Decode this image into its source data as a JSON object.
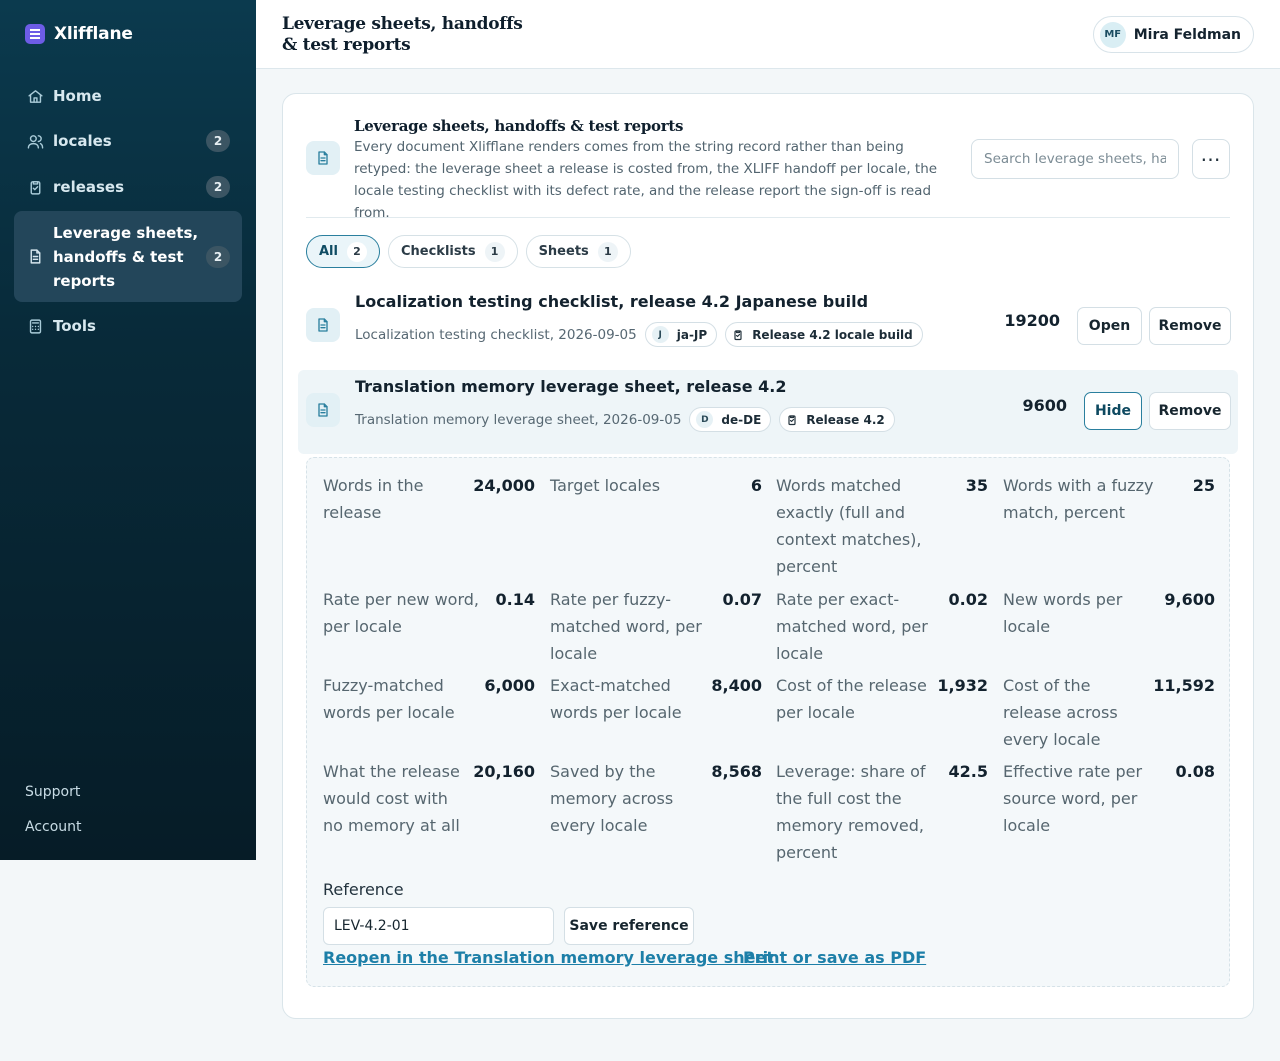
{
  "app": {
    "name": "Xlifflane"
  },
  "sidebar": {
    "items": [
      {
        "label": "Home",
        "icon": "home-icon"
      },
      {
        "label": "locales",
        "badge": "2",
        "icon": "users-icon"
      },
      {
        "label": "releases",
        "badge": "2",
        "icon": "clipboard-icon"
      },
      {
        "label": "Leverage sheets, handoffs & test reports",
        "badge": "2",
        "icon": "document-icon",
        "active": true
      },
      {
        "label": "Tools",
        "icon": "calculator-icon"
      }
    ],
    "footer": {
      "support": "Support",
      "account": "Account"
    }
  },
  "topbar": {
    "title": "Leverage sheets, handoffs & test reports",
    "user": {
      "initials": "MF",
      "name": "Mira Feldman"
    }
  },
  "card": {
    "title": "Leverage sheets, handoffs & test reports",
    "description": "Every document Xlifflane renders comes from the string record rather than being retyped: the leverage sheet a release is costed from, the XLIFF handoff per locale, the locale testing checklist with its defect rate, and the release report the sign-off is read from.",
    "search_placeholder": "Search leverage sheets, handoffs",
    "filters": [
      {
        "label": "All",
        "count": "2",
        "active": true
      },
      {
        "label": "Checklists",
        "count": "1"
      },
      {
        "label": "Sheets",
        "count": "1"
      }
    ],
    "rows": [
      {
        "title": "Localization testing checklist, release 4.2 Japanese build",
        "meta": "Localization testing checklist, 2026-09-05",
        "locale_initial": "J",
        "locale": "ja-JP",
        "release": "Release 4.2 locale build",
        "number": "19200",
        "primary": "Open",
        "remove": "Remove"
      },
      {
        "title": "Translation memory leverage sheet, release 4.2",
        "meta": "Translation memory leverage sheet, 2026-09-05",
        "locale_initial": "D",
        "locale": "de-DE",
        "release": "Release 4.2",
        "number": "9600",
        "primary": "Hide",
        "remove": "Remove"
      }
    ],
    "details": {
      "metrics": [
        {
          "label": "Words in the release",
          "value": "24,000"
        },
        {
          "label": "Target locales",
          "value": "6"
        },
        {
          "label": "Words matched exactly (full and context matches), percent",
          "value": "35"
        },
        {
          "label": "Words with a fuzzy match, percent",
          "value": "25"
        },
        {
          "label": "Rate per new word, per locale",
          "value": "0.14"
        },
        {
          "label": "Rate per fuzzy-matched word, per locale",
          "value": "0.07"
        },
        {
          "label": "Rate per exact-matched word, per locale",
          "value": "0.02"
        },
        {
          "label": "New words per locale",
          "value": "9,600"
        },
        {
          "label": "Fuzzy-matched words per locale",
          "value": "6,000"
        },
        {
          "label": "Exact-matched words per locale",
          "value": "8,400"
        },
        {
          "label": "Cost of the release per locale",
          "value": "1,932"
        },
        {
          "label": "Cost of the release across every locale",
          "value": "11,592"
        },
        {
          "label": "What the release would cost with no memory at all",
          "value": "20,160"
        },
        {
          "label": "Saved by the memory across every locale",
          "value": "8,568"
        },
        {
          "label": "Leverage: share of the full cost the memory removed, percent",
          "value": "42.5"
        },
        {
          "label": "Effective rate per source word, per locale",
          "value": "0.08"
        }
      ],
      "reference_label": "Reference",
      "reference_value": "LEV-4.2-01",
      "save_reference": "Save reference",
      "reopen_link": "Reopen in the Translation memory leverage sheet",
      "print_link": "Print or save as PDF"
    }
  },
  "colors": {
    "accent": "#2a7f9e",
    "link": "#1d7fa8",
    "sidebar": "#082a39",
    "brand": "#6d5ce6"
  }
}
